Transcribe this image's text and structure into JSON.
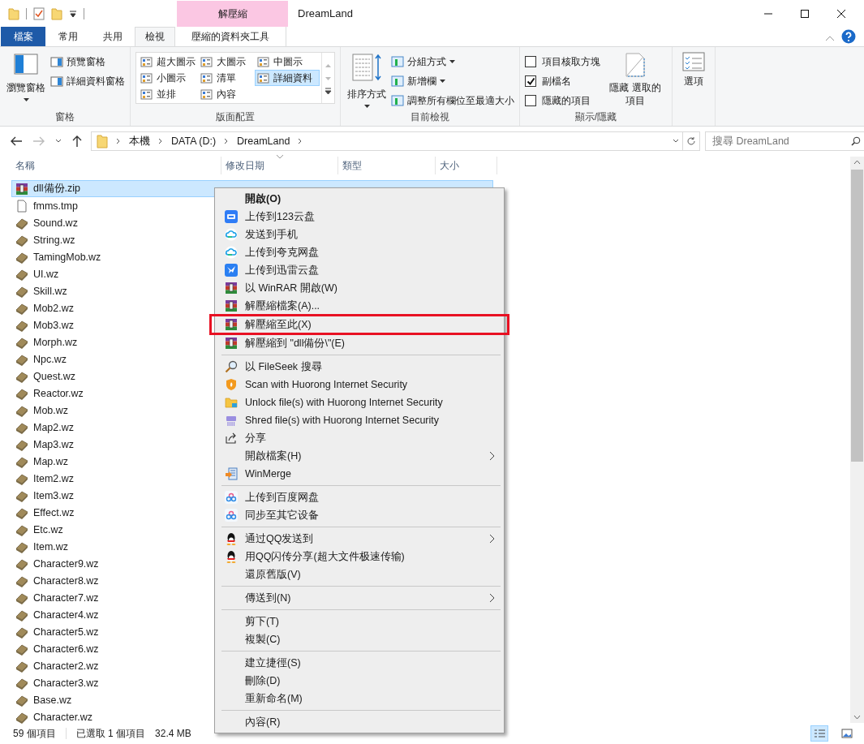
{
  "window": {
    "title": "DreamLand",
    "context_tab_header": "解壓縮"
  },
  "tabs": [
    {
      "label": "檔案",
      "kind": "file",
      "selected": false
    },
    {
      "label": "常用",
      "kind": "tab",
      "selected": false
    },
    {
      "label": "共用",
      "kind": "tab",
      "selected": false
    },
    {
      "label": "檢視",
      "kind": "tab",
      "selected": true
    },
    {
      "label": "壓縮的資料夾工具",
      "kind": "context",
      "selected": false
    }
  ],
  "ribbon": {
    "panes": {
      "label": "窗格",
      "large": "瀏覽窗格",
      "small": [
        "預覽窗格",
        "詳細資料窗格"
      ]
    },
    "layout": {
      "label": "版面配置",
      "options": [
        {
          "label": "超大圖示",
          "selected": false
        },
        {
          "label": "大圖示",
          "selected": false
        },
        {
          "label": "中圖示",
          "selected": false
        },
        {
          "label": "小圖示",
          "selected": false
        },
        {
          "label": "清單",
          "selected": false
        },
        {
          "label": "詳細資料",
          "selected": true
        },
        {
          "label": "並排",
          "selected": false
        },
        {
          "label": "內容",
          "selected": false
        }
      ]
    },
    "current_view": {
      "label": "目前檢視",
      "large": "排序方式",
      "small": [
        {
          "label": "分組方式",
          "dropdown": true
        },
        {
          "label": "新增欄",
          "dropdown": true
        },
        {
          "label": "調整所有欄位至最適大小",
          "dropdown": false
        }
      ]
    },
    "show_hide": {
      "label": "顯示/隱藏",
      "checks": [
        {
          "label": "項目核取方塊",
          "checked": false
        },
        {
          "label": "副檔名",
          "checked": true
        },
        {
          "label": "隱藏的項目",
          "checked": false
        }
      ],
      "large": "隱藏 選取的項目"
    },
    "options": {
      "label": "選項"
    }
  },
  "address": {
    "crumbs": [
      "本機",
      "DATA (D:)",
      "DreamLand"
    ],
    "search_placeholder": "搜尋 DreamLand"
  },
  "columns": [
    "名稱",
    "修改日期",
    "類型",
    "大小"
  ],
  "files": [
    {
      "name": "dll備份.zip",
      "kind": "zip",
      "selected": true
    },
    {
      "name": "fmms.tmp",
      "kind": "tmp",
      "selected": false
    },
    {
      "name": "Sound.wz",
      "kind": "wz",
      "selected": false
    },
    {
      "name": "String.wz",
      "kind": "wz",
      "selected": false
    },
    {
      "name": "TamingMob.wz",
      "kind": "wz",
      "selected": false
    },
    {
      "name": "UI.wz",
      "kind": "wz",
      "selected": false
    },
    {
      "name": "Skill.wz",
      "kind": "wz",
      "selected": false
    },
    {
      "name": "Mob2.wz",
      "kind": "wz",
      "selected": false
    },
    {
      "name": "Mob3.wz",
      "kind": "wz",
      "selected": false
    },
    {
      "name": "Morph.wz",
      "kind": "wz",
      "selected": false
    },
    {
      "name": "Npc.wz",
      "kind": "wz",
      "selected": false
    },
    {
      "name": "Quest.wz",
      "kind": "wz",
      "selected": false
    },
    {
      "name": "Reactor.wz",
      "kind": "wz",
      "selected": false
    },
    {
      "name": "Mob.wz",
      "kind": "wz",
      "selected": false
    },
    {
      "name": "Map2.wz",
      "kind": "wz",
      "selected": false
    },
    {
      "name": "Map3.wz",
      "kind": "wz",
      "selected": false
    },
    {
      "name": "Map.wz",
      "kind": "wz",
      "selected": false
    },
    {
      "name": "Item2.wz",
      "kind": "wz",
      "selected": false
    },
    {
      "name": "Item3.wz",
      "kind": "wz",
      "selected": false
    },
    {
      "name": "Effect.wz",
      "kind": "wz",
      "selected": false
    },
    {
      "name": "Etc.wz",
      "kind": "wz",
      "selected": false
    },
    {
      "name": "Item.wz",
      "kind": "wz",
      "selected": false
    },
    {
      "name": "Character9.wz",
      "kind": "wz",
      "selected": false
    },
    {
      "name": "Character8.wz",
      "kind": "wz",
      "selected": false
    },
    {
      "name": "Character7.wz",
      "kind": "wz",
      "selected": false
    },
    {
      "name": "Character4.wz",
      "kind": "wz",
      "selected": false
    },
    {
      "name": "Character5.wz",
      "kind": "wz",
      "selected": false
    },
    {
      "name": "Character6.wz",
      "kind": "wz",
      "selected": false
    },
    {
      "name": "Character2.wz",
      "kind": "wz",
      "selected": false
    },
    {
      "name": "Character3.wz",
      "kind": "wz",
      "selected": false
    },
    {
      "name": "Base.wz",
      "kind": "wz",
      "selected": false
    },
    {
      "name": "Character.wz",
      "kind": "wz",
      "selected": false
    }
  ],
  "context_menu": {
    "groups": [
      {
        "items": [
          {
            "label": "開啟(O)",
            "kind": "none",
            "default": true,
            "submenu": false,
            "outlined": false
          },
          {
            "label": "上传到123云盘",
            "kind": "app123",
            "default": false,
            "submenu": false,
            "outlined": false
          },
          {
            "label": "发送到手机",
            "kind": "cloud",
            "default": false,
            "submenu": false,
            "outlined": false
          },
          {
            "label": "上传到夸克网盘",
            "kind": "cloud",
            "default": false,
            "submenu": false,
            "outlined": false
          },
          {
            "label": "上传到迅雷云盘",
            "kind": "bird",
            "default": false,
            "submenu": false,
            "outlined": false
          },
          {
            "label": "以 WinRAR 開啟(W)",
            "kind": "winrar",
            "default": false,
            "submenu": false,
            "outlined": false
          },
          {
            "label": "解壓縮檔案(A)...",
            "kind": "winrar",
            "default": false,
            "submenu": false,
            "outlined": false
          },
          {
            "label": "解壓縮至此(X)",
            "kind": "winrar",
            "default": false,
            "submenu": false,
            "outlined": true
          },
          {
            "label": "解壓縮到 \"dll備份\\\"(E)",
            "kind": "winrar",
            "default": false,
            "submenu": false,
            "outlined": false
          }
        ]
      },
      {
        "items": [
          {
            "label": "以 FileSeek 搜尋",
            "kind": "magnifier",
            "default": false,
            "submenu": false,
            "outlined": false
          },
          {
            "label": "Scan with Huorong Internet Security",
            "kind": "shield",
            "default": false,
            "submenu": false,
            "outlined": false
          },
          {
            "label": "Unlock file(s) with Huorong Internet Security",
            "kind": "folder",
            "default": false,
            "submenu": false,
            "outlined": false
          },
          {
            "label": "Shred file(s) with Huorong Internet Security",
            "kind": "shredder",
            "default": false,
            "submenu": false,
            "outlined": false
          },
          {
            "label": "分享",
            "kind": "share",
            "default": false,
            "submenu": false,
            "outlined": false
          },
          {
            "label": "開啟檔案(H)",
            "kind": "none",
            "default": false,
            "submenu": true,
            "outlined": false
          },
          {
            "label": "WinMerge",
            "kind": "winmerge",
            "default": false,
            "submenu": false,
            "outlined": false
          }
        ]
      },
      {
        "items": [
          {
            "label": "上传到百度网盘",
            "kind": "baidu",
            "default": false,
            "submenu": false,
            "outlined": false
          },
          {
            "label": "同步至其它设备",
            "kind": "baidu",
            "default": false,
            "submenu": false,
            "outlined": false
          }
        ]
      },
      {
        "items": [
          {
            "label": "通过QQ发送到",
            "kind": "qq",
            "default": false,
            "submenu": true,
            "outlined": false
          },
          {
            "label": "用QQ闪传分享(超大文件极速传输)",
            "kind": "qq",
            "default": false,
            "submenu": false,
            "outlined": false
          },
          {
            "label": "還原舊版(V)",
            "kind": "none",
            "default": false,
            "submenu": false,
            "outlined": false
          }
        ]
      },
      {
        "items": [
          {
            "label": "傳送到(N)",
            "kind": "none",
            "default": false,
            "submenu": true,
            "outlined": false
          }
        ]
      },
      {
        "items": [
          {
            "label": "剪下(T)",
            "kind": "none",
            "default": false,
            "submenu": false,
            "outlined": false
          },
          {
            "label": "複製(C)",
            "kind": "none",
            "default": false,
            "submenu": false,
            "outlined": false
          }
        ]
      },
      {
        "items": [
          {
            "label": "建立捷徑(S)",
            "kind": "none",
            "default": false,
            "submenu": false,
            "outlined": false
          },
          {
            "label": "刪除(D)",
            "kind": "none",
            "default": false,
            "submenu": false,
            "outlined": false
          },
          {
            "label": "重新命名(M)",
            "kind": "none",
            "default": false,
            "submenu": false,
            "outlined": false
          }
        ]
      },
      {
        "items": [
          {
            "label": "內容(R)",
            "kind": "none",
            "default": false,
            "submenu": false,
            "outlined": false
          }
        ]
      }
    ]
  },
  "status_bar": {
    "count": "59 個項目",
    "selection": "已選取 1 個項目",
    "size": "32.4 MB"
  }
}
